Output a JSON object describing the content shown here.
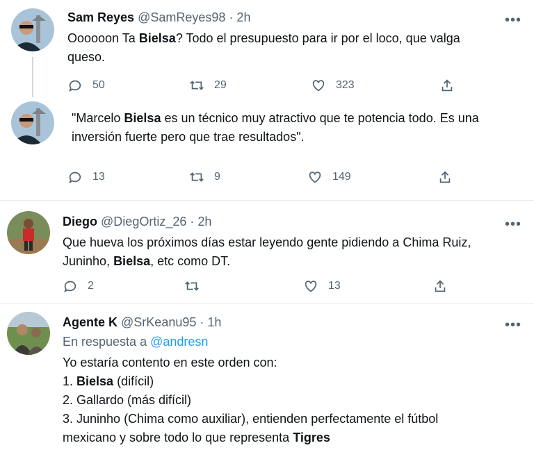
{
  "tweets": [
    {
      "name": "Sam Reyes",
      "handle": "@SamReyes98",
      "time": "· 2h",
      "text": [
        "Oooooon Ta ",
        "Bielsa",
        "? Todo el presupuesto para ir por el loco, que valga",
        "queso."
      ],
      "replies": "50",
      "retweets": "29",
      "likes": "323"
    },
    {
      "text": [
        "\"Marcelo ",
        "Bielsa",
        " es un técnico muy atractivo que te potencia todo. Es una",
        "inversión fuerte pero que trae resultados\"."
      ],
      "replies": "13",
      "retweets": "9",
      "likes": "149"
    },
    {
      "name": "Diego",
      "handle": "@DiegOrtiz_26",
      "time": "· 2h",
      "text": [
        "Que hueva los próximos días estar leyendo gente pidiendo a Chima Ruiz,",
        "Juninho, ",
        "Bielsa",
        ", etc como DT."
      ],
      "replies": "2",
      "retweets": "",
      "likes": "13"
    },
    {
      "name": "Agente K",
      "handle": "@SrKeanu95",
      "time": "· 1h",
      "reply_prefix": "En respuesta a ",
      "reply_to": "@andresn",
      "lines": [
        "Yo estaría contento en este orden con:",
        [
          "1. ",
          "Bielsa",
          " (difícil)"
        ],
        "2. Gallardo (más difícil)",
        "3. Juninho (Chima como auxiliar), entienden perfectamente el fútbol",
        [
          "mexicano y sobre todo lo que representa ",
          "Tigres",
          ""
        ]
      ]
    }
  ],
  "more_label": "•••",
  "icons": [
    "reply-icon",
    "retweet-icon",
    "like-icon",
    "share-icon"
  ]
}
